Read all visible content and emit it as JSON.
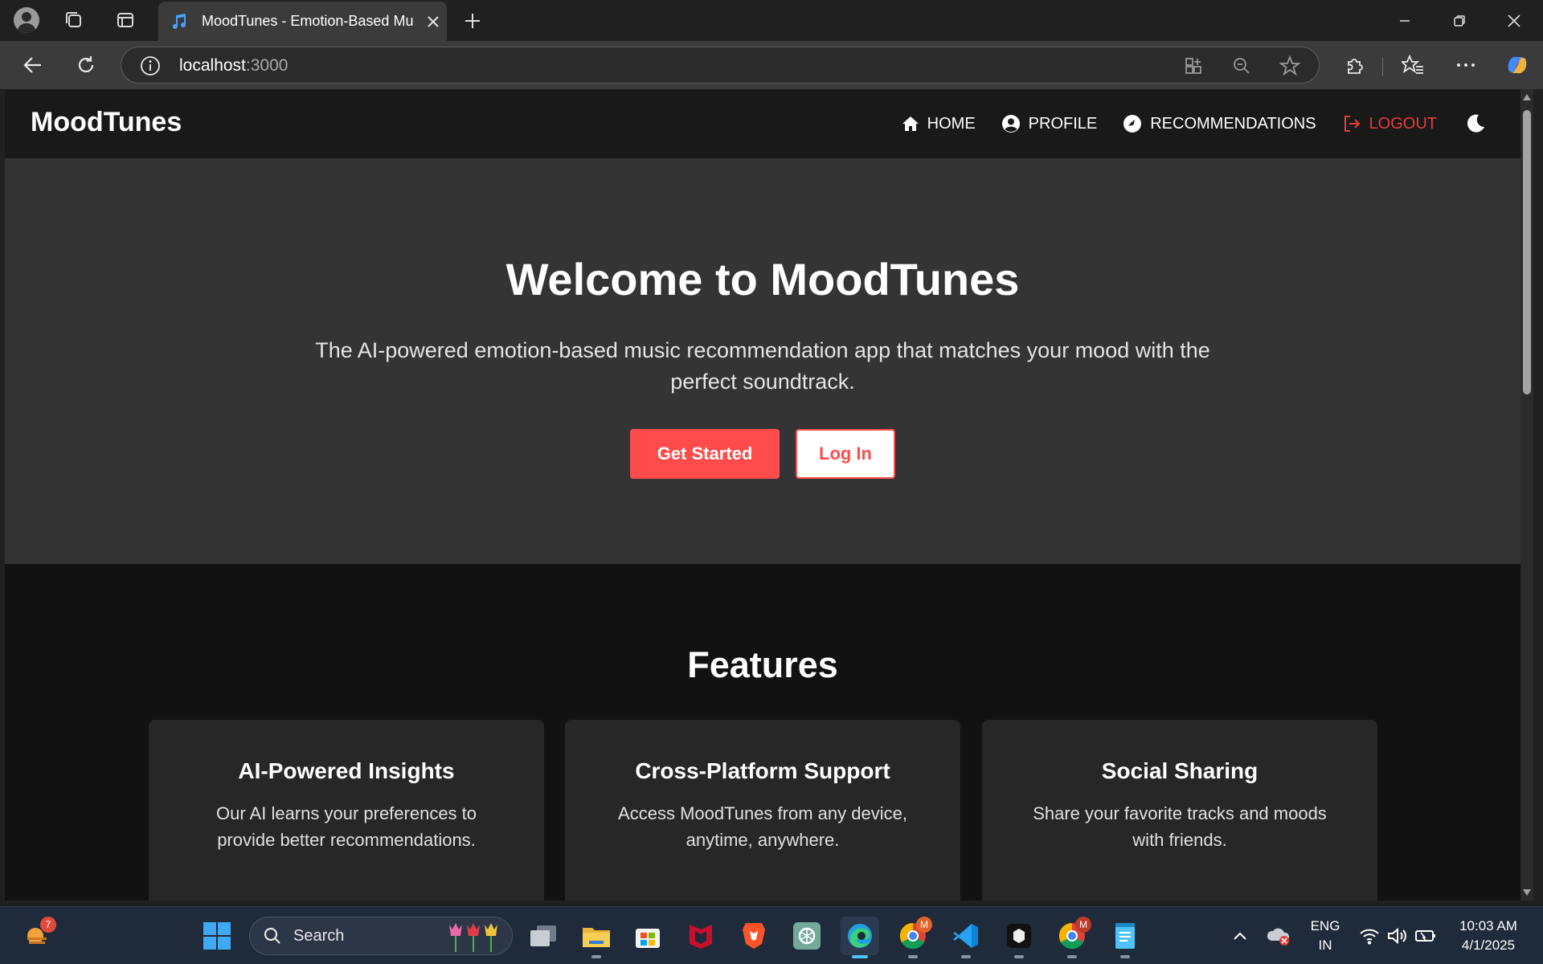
{
  "browser": {
    "tab_title": "MoodTunes - Emotion-Based Mu",
    "url_host": "localhost",
    "url_port": ":3000"
  },
  "app": {
    "brand": "MoodTunes",
    "nav": {
      "home": "HOME",
      "profile": "PROFILE",
      "recommendations": "RECOMMENDATIONS",
      "logout": "LOGOUT"
    },
    "hero": {
      "title": "Welcome to MoodTunes",
      "subtitle": "The AI-powered emotion-based music recommendation app that matches your mood with the perfect soundtrack.",
      "primary_button": "Get Started",
      "secondary_button": "Log In"
    },
    "features": {
      "title": "Features",
      "cards": [
        {
          "title": "AI-Powered Insights",
          "text": "Our AI learns your preferences to provide better recommendations."
        },
        {
          "title": "Cross-Platform Support",
          "text": "Access MoodTunes from any device, anytime, anywhere."
        },
        {
          "title": "Social Sharing",
          "text": "Share your favorite tracks and moods with friends."
        }
      ]
    },
    "colors": {
      "accent": "#ff4b4b",
      "logout": "#e83b3b"
    }
  },
  "taskbar": {
    "search_placeholder": "Search",
    "weather_badge": "7",
    "chrome_badge": "M",
    "lang_line1": "ENG",
    "lang_line2": "IN",
    "time": "10:03 AM",
    "date": "4/1/2025"
  }
}
